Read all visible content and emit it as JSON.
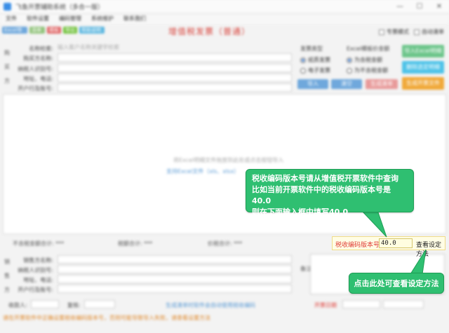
{
  "app": {
    "title": "飞鱼开票辅助系统（多合一版）",
    "win_min": "—",
    "win_max": "☐",
    "win_close": "✕"
  },
  "menu": [
    "文件",
    "软件设置",
    "编码管理",
    "系统维护",
    "联系我们"
  ],
  "toolbar": {
    "chips": [
      {
        "label": "Excel导入",
        "color": "#6fa8dc"
      },
      {
        "label": "清单",
        "color": "#93c47d"
      },
      {
        "label": "模板",
        "color": "#e06666"
      },
      {
        "label": "导出",
        "color": "#76c442"
      },
      {
        "label": "帮助说明",
        "color": "#5fb8e0"
      }
    ],
    "doc_title": "增值税发票（普通）",
    "check_1": "专票模式",
    "check_2": "自动清单"
  },
  "buyer": {
    "side_labels": [
      "购",
      "买",
      "方"
    ],
    "fields": [
      {
        "label": "名称检索:",
        "placeholder": "输入客户名称关键字检索"
      },
      {
        "label": "购买方名称:",
        "placeholder": ""
      },
      {
        "label": "纳税人识别号:",
        "placeholder": ""
      },
      {
        "label": "地址、电话:",
        "placeholder": ""
      },
      {
        "label": "开户行及账号:",
        "placeholder": ""
      }
    ]
  },
  "options": {
    "invoice_type_title": "发票类型",
    "invoice_types": [
      "纸质发票",
      "电子发票"
    ],
    "amount_title": "Excel模板价金额",
    "amount_types": [
      "为含税金额",
      "为不含税金额"
    ]
  },
  "buttons": {
    "btn_1": "导入",
    "btn_2": "清空",
    "btn_3": "生成清单",
    "right_1": "导入Excel明细",
    "right_2": "删除选定明细",
    "right_3": "生成开票文件"
  },
  "panel": {
    "hint_1": "将Excel明细文件拖放到此处或点击按钮导入",
    "hint_2": "支持Excel文件（xls、xlsx）"
  },
  "totals": {
    "t1": "不含税金额合计: ***",
    "t2": "税额合计: ***",
    "t3": "价税合计: ***"
  },
  "seller": {
    "side_labels": [
      "销",
      "售",
      "方"
    ],
    "fields": [
      {
        "label": "销售方名称:"
      },
      {
        "label": "纳税人识别号:"
      },
      {
        "label": "地址、电话:"
      },
      {
        "label": "开户行及账号:"
      }
    ],
    "note_label": "备注"
  },
  "footer": {
    "payee": "收款人:",
    "reviewer": "复核:",
    "link": "生成清单时软件会自动使用税收编码",
    "invoice_date": "开票日期",
    "note": "请在开票软件中正确设置税收编码版本号，否则可能导致导入失败，请查看设置方法"
  },
  "code_setting": {
    "label": "税收编码版本号:",
    "value": "40.0",
    "link": "查看设定方法"
  },
  "callouts": {
    "tip_line_1": "税收编码版本号请从增值税开票软件中查询",
    "tip_line_2": "比如当前开票软件中的税收编码版本号是40.0",
    "tip_line_3": "则在下面输入框中填写40.0",
    "tip_2": "点击此处可查看设定方法"
  }
}
